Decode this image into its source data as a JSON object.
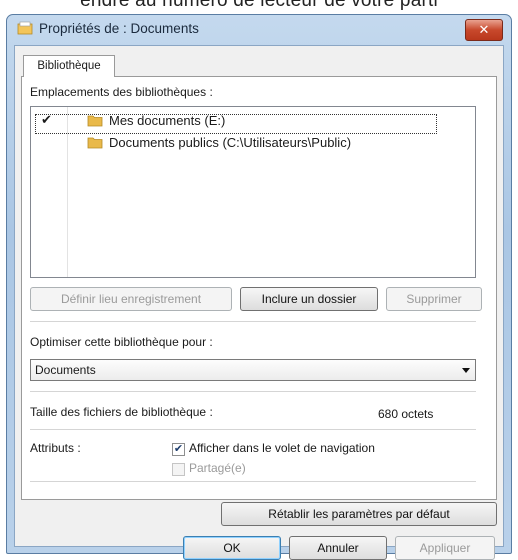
{
  "background_text": "endre au numéro de lecteur de votre parti",
  "window": {
    "title": "Propriétés de : Documents",
    "close_label": "✕"
  },
  "tabs": [
    {
      "label": "Bibliothèque"
    }
  ],
  "locations": {
    "label": "Emplacements des bibliothèques :",
    "items": [
      {
        "checked": true,
        "check_mark": "✔",
        "text": "Mes documents (E:)"
      },
      {
        "checked": false,
        "check_mark": "",
        "text": "Documents publics (C:\\Utilisateurs\\Public)"
      }
    ]
  },
  "buttons": {
    "set_save_location": "Définir lieu enregistrement",
    "include_folder": "Inclure un dossier",
    "remove": "Supprimer"
  },
  "optimize": {
    "label": "Optimiser cette bibliothèque pour :",
    "selected": "Documents"
  },
  "size": {
    "label": "Taille des fichiers de bibliothèque :",
    "value": "680 octets"
  },
  "attributes": {
    "label": "Attributs :",
    "show_in_nav": {
      "label": "Afficher dans le volet de navigation",
      "checked": true,
      "mark": "✔"
    },
    "shared": {
      "label": "Partagé(e)",
      "checked": false,
      "enabled": false
    }
  },
  "restore_defaults": "Rétablir les paramètres par défaut",
  "footer": {
    "ok": "OK",
    "cancel": "Annuler",
    "apply": "Appliquer"
  },
  "colors": {
    "close_button": "#c8492c",
    "folder": "#e9b94a"
  }
}
